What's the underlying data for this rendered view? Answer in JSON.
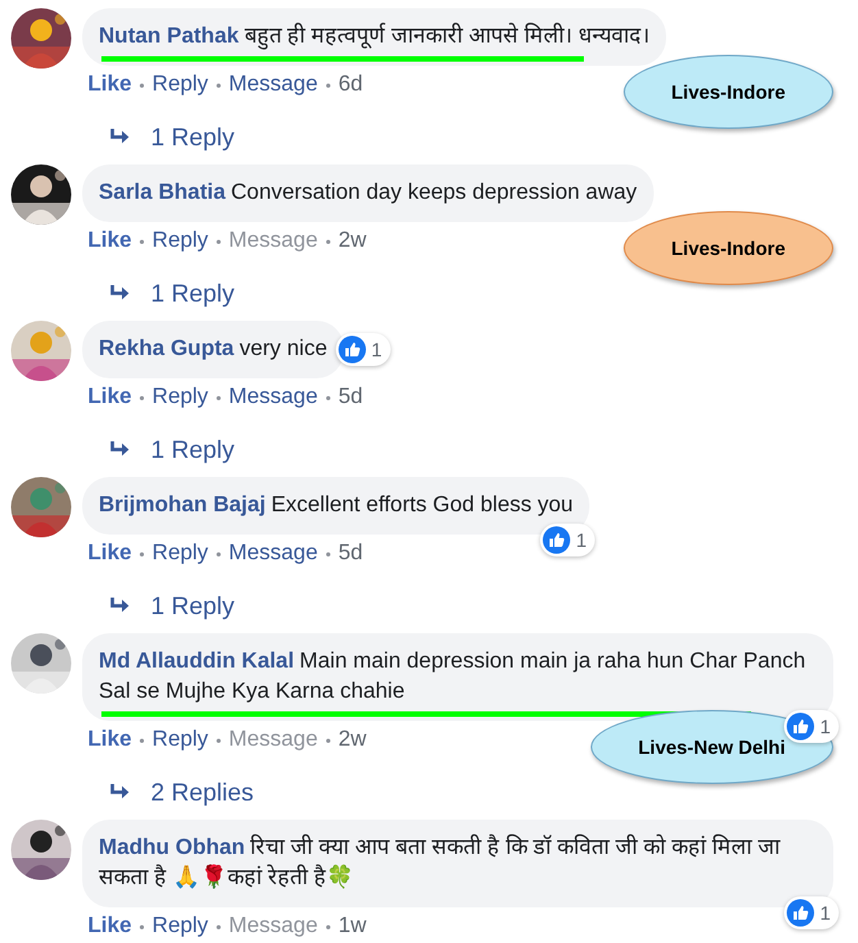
{
  "comments": [
    {
      "author": "Nutan Pathak",
      "text": "बहुत ही महत्वपूर्ण जानकारी आपसे मिली। धन्यवाद।",
      "highlighted": true,
      "like": "Like",
      "reply": "Reply",
      "message": "Message",
      "message_disabled": false,
      "time": "6d",
      "replies": "1 Reply",
      "annotation": {
        "label": "Lives-Indore",
        "color": "#bdeaf7"
      }
    },
    {
      "author": "Sarla Bhatia",
      "text": "Conversation day keeps depression away",
      "highlighted": false,
      "like": "Like",
      "reply": "Reply",
      "message": "Message",
      "message_disabled": true,
      "time": "2w",
      "replies": "1 Reply",
      "annotation": {
        "label": "Lives-Indore",
        "color": "#f8c08e"
      }
    },
    {
      "author": "Rekha Gupta",
      "text": "very nice",
      "highlighted": false,
      "reaction": {
        "count": "1",
        "kind": "side"
      },
      "like": "Like",
      "reply": "Reply",
      "message": "Message",
      "message_disabled": false,
      "time": "5d",
      "replies": "1 Reply"
    },
    {
      "author": "Brijmohan Bajaj",
      "text": "Excellent efforts God bless you",
      "highlighted": false,
      "reaction": {
        "count": "1",
        "kind": "corner"
      },
      "like": "Like",
      "reply": "Reply",
      "message": "Message",
      "message_disabled": false,
      "time": "5d",
      "replies": "1 Reply"
    },
    {
      "author": "Md Allauddin Kalal",
      "text": "Main main depression main ja raha hun Char Panch Sal se Mujhe Kya Karna chahie",
      "highlighted": true,
      "reaction": {
        "count": "1",
        "kind": "corner"
      },
      "like": "Like",
      "reply": "Reply",
      "message": "Message",
      "message_disabled": true,
      "time": "2w",
      "replies": "2 Replies",
      "annotation": {
        "label": "Lives-New Delhi",
        "color": "#bdeaf7"
      }
    },
    {
      "author": "Madhu Obhan",
      "text": "रिचा जी क्या आप बता सकती है कि डॉ कविता जी को कहां मिला जा सकता है 🙏🌹कहां रेहती है🍀",
      "highlighted": false,
      "reaction": {
        "count": "1",
        "kind": "corner"
      },
      "like": "Like",
      "reply": "Reply",
      "message": "Message",
      "message_disabled": true,
      "time": "1w"
    }
  ]
}
